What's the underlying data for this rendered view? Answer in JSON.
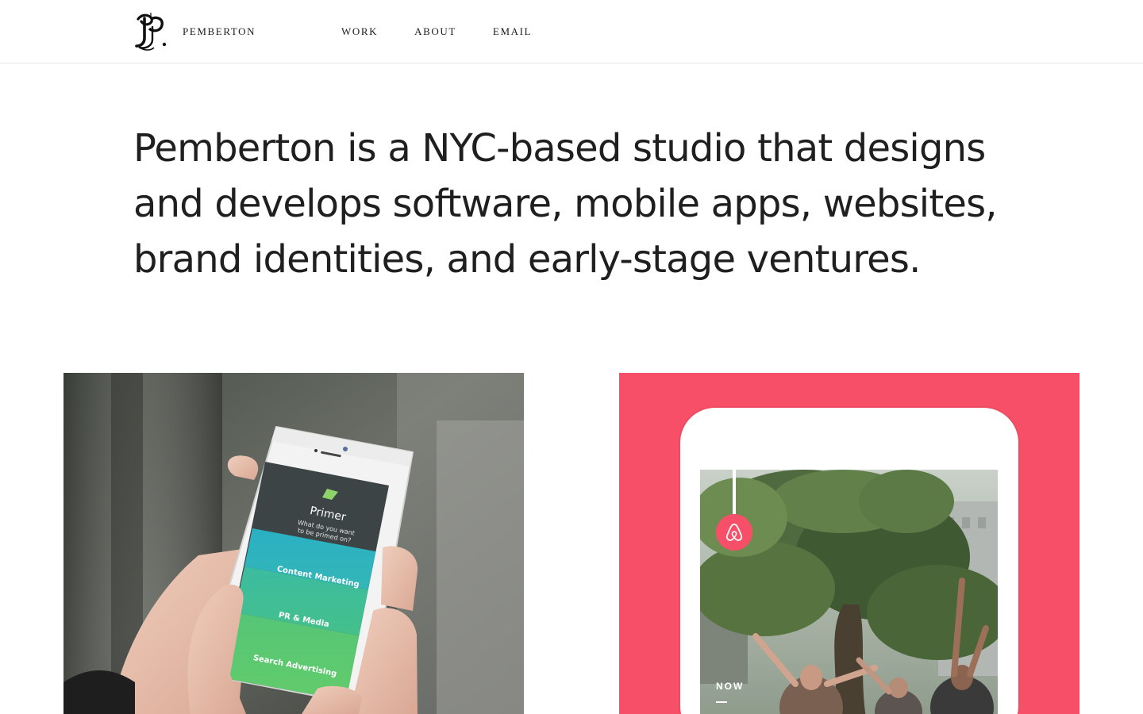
{
  "header": {
    "logo_text": "PEMBERTON",
    "logo_icon": "pemberton-blackletter-p-monogram",
    "nav": [
      {
        "label": "WORK"
      },
      {
        "label": "ABOUT"
      },
      {
        "label": "EMAIL"
      }
    ]
  },
  "intro": {
    "text": "Pemberton is a NYC-based studio that designs and develops software, mobile apps, websites, brand identities, and early-stage ventures."
  },
  "projects": [
    {
      "name": "Primer",
      "screen": {
        "app_title": "Primer",
        "question_line1": "What do you want",
        "question_line2": "to be primed on?",
        "options": [
          "Content Marketing",
          "PR & Media",
          "Search Advertising"
        ]
      },
      "colors": {
        "option1": "#2ab0c4",
        "option2": "#3fbf94",
        "option3": "#5bc86f"
      }
    },
    {
      "name": "Airbnb",
      "screen": {
        "label": "NOW",
        "badge_icon": "airbnb-belo-icon"
      },
      "colors": {
        "background": "#f64f67"
      }
    }
  ]
}
